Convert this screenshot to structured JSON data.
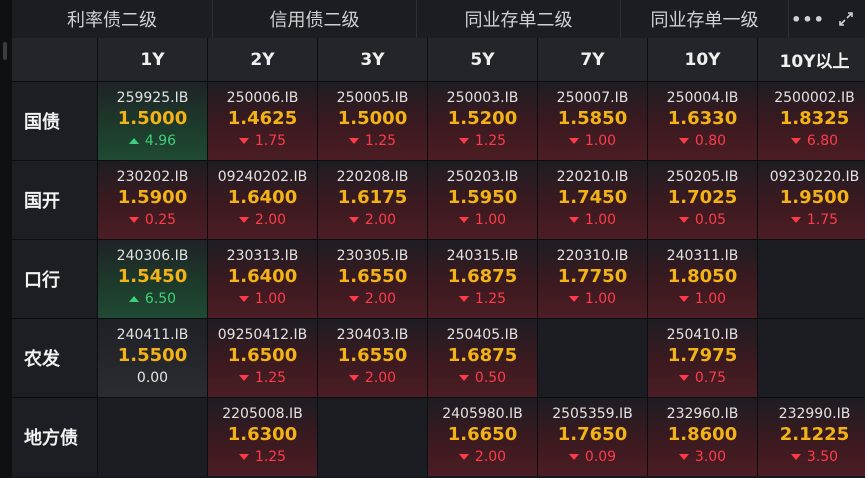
{
  "tabs": [
    {
      "label": "利率债二级",
      "active": true
    },
    {
      "label": "信用债二级",
      "active": false
    },
    {
      "label": "同业存单二级",
      "active": false
    },
    {
      "label": "同业存单一级",
      "active": false
    }
  ],
  "more_label": "•••",
  "columns": [
    "1Y",
    "2Y",
    "3Y",
    "5Y",
    "7Y",
    "10Y",
    "10Y以上"
  ],
  "rows": [
    {
      "label": "国债",
      "cells": [
        {
          "code": "259925.IB",
          "yield": "1.5000",
          "change": "4.96",
          "dir": "up"
        },
        {
          "code": "250006.IB",
          "yield": "1.4625",
          "change": "1.75",
          "dir": "down"
        },
        {
          "code": "250005.IB",
          "yield": "1.5000",
          "change": "1.25",
          "dir": "down"
        },
        {
          "code": "250003.IB",
          "yield": "1.5200",
          "change": "1.25",
          "dir": "down"
        },
        {
          "code": "250007.IB",
          "yield": "1.5850",
          "change": "1.00",
          "dir": "down"
        },
        {
          "code": "250004.IB",
          "yield": "1.6330",
          "change": "0.80",
          "dir": "down"
        },
        {
          "code": "2500002.IB",
          "yield": "1.8325",
          "change": "6.80",
          "dir": "down"
        }
      ]
    },
    {
      "label": "国开",
      "cells": [
        {
          "code": "230202.IB",
          "yield": "1.5900",
          "change": "0.25",
          "dir": "down"
        },
        {
          "code": "09240202.IB",
          "yield": "1.6400",
          "change": "2.00",
          "dir": "down"
        },
        {
          "code": "220208.IB",
          "yield": "1.6175",
          "change": "2.00",
          "dir": "down"
        },
        {
          "code": "250203.IB",
          "yield": "1.5950",
          "change": "1.00",
          "dir": "down"
        },
        {
          "code": "220210.IB",
          "yield": "1.7450",
          "change": "1.00",
          "dir": "down"
        },
        {
          "code": "250205.IB",
          "yield": "1.7025",
          "change": "0.05",
          "dir": "down"
        },
        {
          "code": "09230220.IB",
          "yield": "1.9500",
          "change": "1.75",
          "dir": "down"
        }
      ]
    },
    {
      "label": "口行",
      "cells": [
        {
          "code": "240306.IB",
          "yield": "1.5450",
          "change": "6.50",
          "dir": "up"
        },
        {
          "code": "230313.IB",
          "yield": "1.6400",
          "change": "1.00",
          "dir": "down"
        },
        {
          "code": "230305.IB",
          "yield": "1.6550",
          "change": "2.00",
          "dir": "down"
        },
        {
          "code": "240315.IB",
          "yield": "1.6875",
          "change": "1.25",
          "dir": "down"
        },
        {
          "code": "220310.IB",
          "yield": "1.7750",
          "change": "1.00",
          "dir": "down"
        },
        {
          "code": "240311.IB",
          "yield": "1.8050",
          "change": "1.00",
          "dir": "down"
        },
        null
      ]
    },
    {
      "label": "农发",
      "cells": [
        {
          "code": "240411.IB",
          "yield": "1.5500",
          "change": "0.00",
          "dir": "flat"
        },
        {
          "code": "09250412.IB",
          "yield": "1.6500",
          "change": "1.25",
          "dir": "down"
        },
        {
          "code": "230403.IB",
          "yield": "1.6550",
          "change": "2.00",
          "dir": "down"
        },
        {
          "code": "250405.IB",
          "yield": "1.6875",
          "change": "0.50",
          "dir": "down"
        },
        null,
        {
          "code": "250410.IB",
          "yield": "1.7975",
          "change": "0.75",
          "dir": "down"
        },
        null
      ]
    },
    {
      "label": "地方债",
      "cells": [
        null,
        {
          "code": "2205008.IB",
          "yield": "1.6300",
          "change": "1.25",
          "dir": "down"
        },
        null,
        {
          "code": "2405980.IB",
          "yield": "1.6650",
          "change": "2.00",
          "dir": "down"
        },
        {
          "code": "2505359.IB",
          "yield": "1.7650",
          "change": "0.09",
          "dir": "down"
        },
        {
          "code": "232960.IB",
          "yield": "1.8600",
          "change": "3.00",
          "dir": "down"
        },
        {
          "code": "232990.IB",
          "yield": "2.1225",
          "change": "3.50",
          "dir": "down"
        }
      ]
    }
  ],
  "colors": {
    "yield": "#f3b316",
    "down": "#ff3b4a",
    "up": "#3ecf7a",
    "bg": "#17181c"
  }
}
